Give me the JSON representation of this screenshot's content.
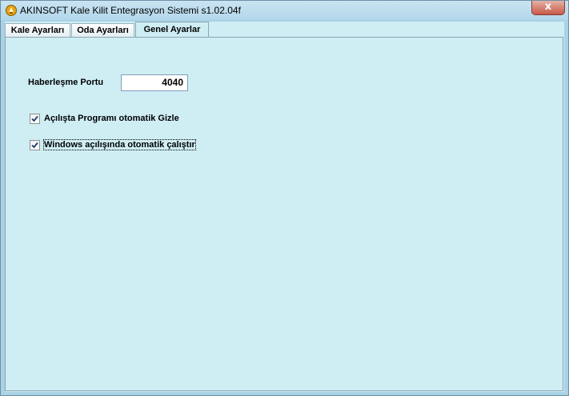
{
  "window": {
    "title": "AKINSOFT Kale Kilit Entegrasyon Sistemi s1.02.04f",
    "close_glyph": "x"
  },
  "tabs": [
    {
      "label": "Kale Ayarları",
      "active": false
    },
    {
      "label": "Oda Ayarları",
      "active": false
    },
    {
      "label": "Genel Ayarlar",
      "active": true
    }
  ],
  "general": {
    "port_label": "Haberleşme Portu",
    "port_value": "4040",
    "hide_on_start": {
      "label": "Açılışta Programı otomatik Gizle",
      "checked": true
    },
    "autostart": {
      "label": "Windows açılışında otomatik çalıştır",
      "checked": true
    }
  },
  "colors": {
    "background": "#cfeef4",
    "frame": "#a9d2e4",
    "close_button": "#c75a48"
  },
  "icons": {
    "app": "akinsoft-logo-icon",
    "close": "close-icon",
    "check": "checkmark-icon"
  }
}
